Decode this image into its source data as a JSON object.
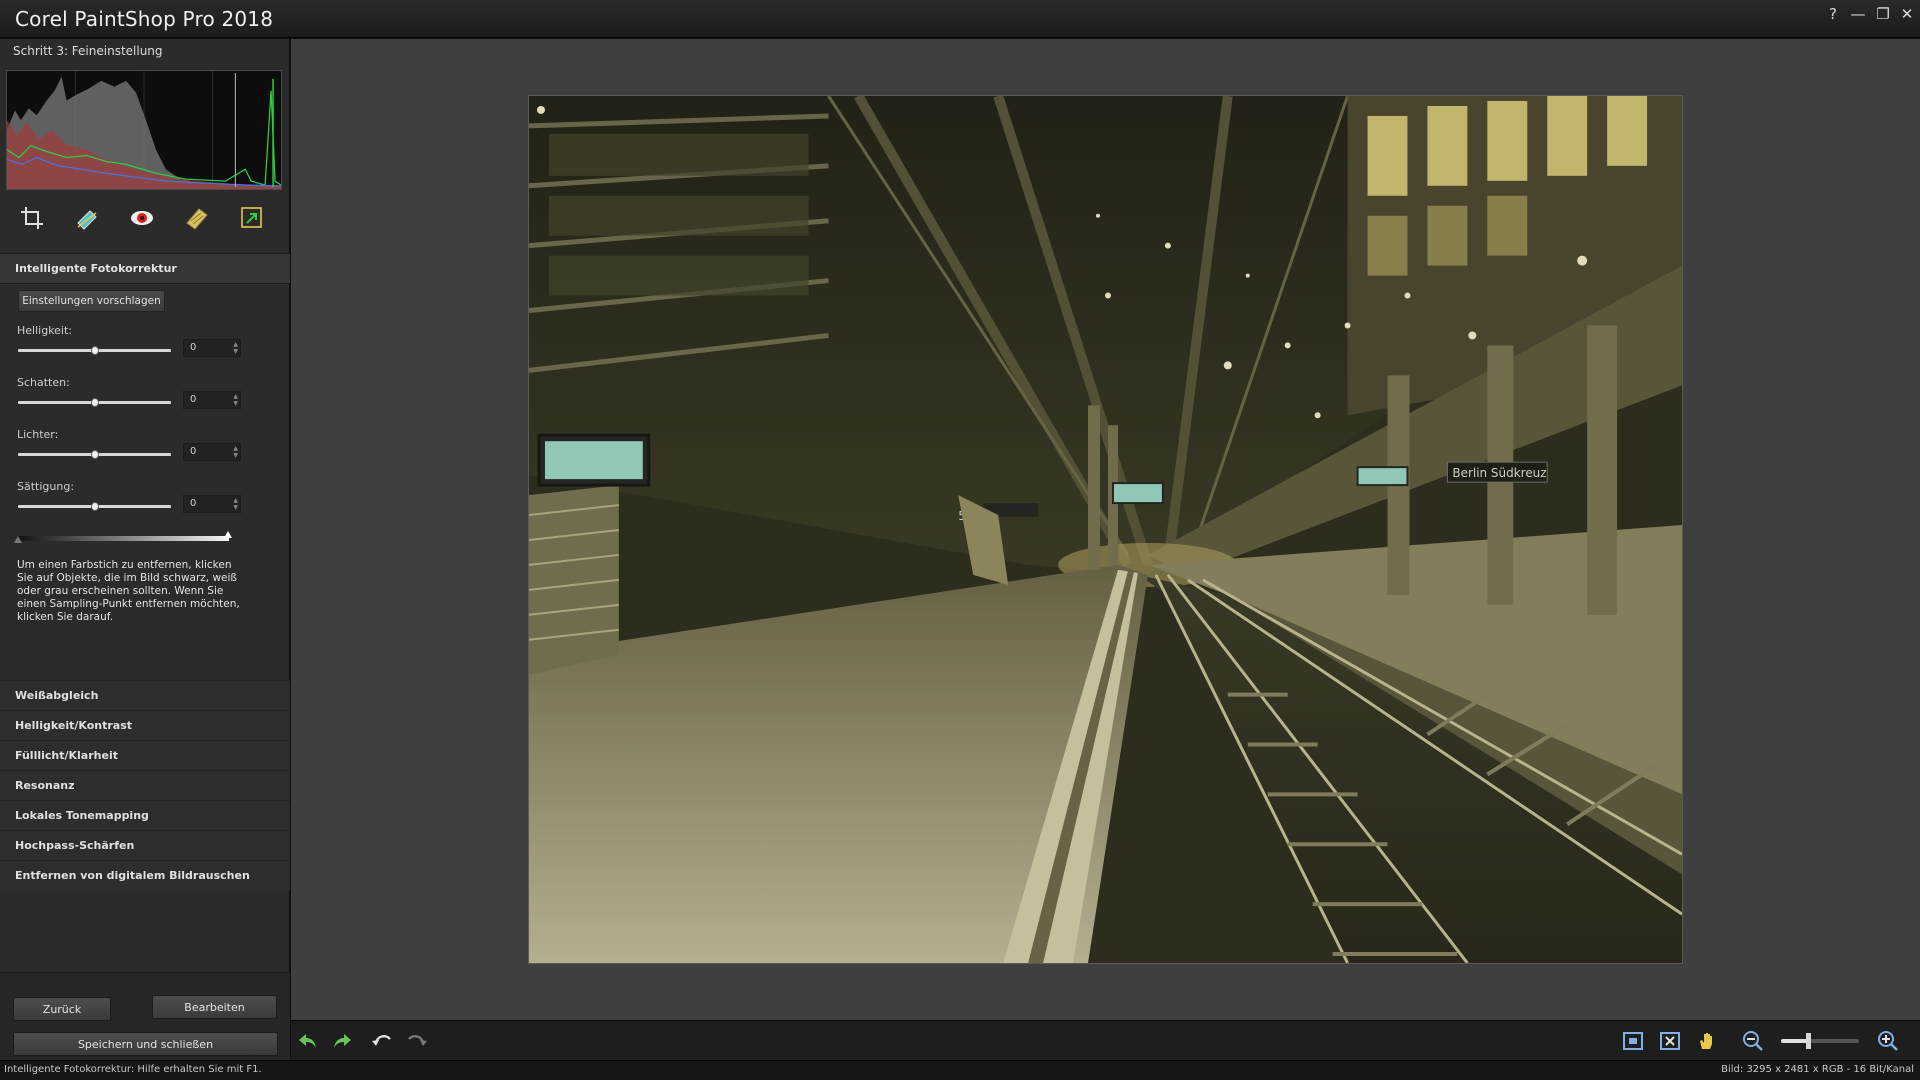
{
  "window": {
    "title": "Corel PaintShop Pro 2018",
    "controls": {
      "help": "?",
      "minimize": "—",
      "restore": "❐",
      "close": "✕"
    }
  },
  "panel": {
    "step": "Schritt 3: Feineinstellung",
    "section_title": "Intelligente Fotokorrektur",
    "suggest_button": "Einstellungen vorschlagen",
    "tools": [
      "crop-icon",
      "straighten-icon",
      "red-eye-icon",
      "retouch-icon",
      "resize-icon"
    ],
    "adjustments": [
      {
        "label": "Helligkeit:",
        "value": "0",
        "position": 0.5
      },
      {
        "label": "Schatten:",
        "value": "0",
        "position": 0.5
      },
      {
        "label": "Lichter:",
        "value": "0",
        "position": 0.5
      },
      {
        "label": "Sättigung:",
        "value": "0",
        "position": 0.5
      }
    ],
    "cast_help": "Um einen Farbstich zu entfernen, klicken Sie auf Objekte, die im Bild schwarz, weiß oder grau erscheinen sollten. Wenn Sie einen Sampling-Punkt entfernen möchten, klicken Sie darauf.",
    "accordion": [
      "Weißabgleich",
      "Helligkeit/Kontrast",
      "Fülllicht/Klarheit",
      "Resonanz",
      "Lokales Tonemapping",
      "Hochpass-Schärfen",
      "Entfernen von digitalem Bildrauschen"
    ],
    "buttons": {
      "back": "Zurück",
      "edit": "Bearbeiten",
      "save_close": "Speichern und schließen"
    }
  },
  "photo": {
    "platform_sign": "Berlin Südkreuz",
    "track_sign": "5 B",
    "tint": "#3c3a20"
  },
  "toolbar": {
    "left_icons": [
      "undo-icon",
      "redo-icon",
      "rotate-left-icon",
      "rotate-right-icon"
    ],
    "right_icons": [
      "fit-window-icon",
      "actual-size-icon",
      "pan-hand-icon",
      "zoom-out-icon",
      "zoom-in-icon"
    ],
    "zoom_level": 0.35
  },
  "status": {
    "left": "Intelligente Fotokorrektur: Hilfe erhalten Sie mit F1.",
    "right": "Bild: 3295 x 2481 x RGB - 16 Bit/Kanal"
  },
  "colors": {
    "accent": "#e8c84a",
    "histogram_red": "#c0392b",
    "histogram_green": "#2ecc40",
    "histogram_blue": "#3b6bd6"
  }
}
